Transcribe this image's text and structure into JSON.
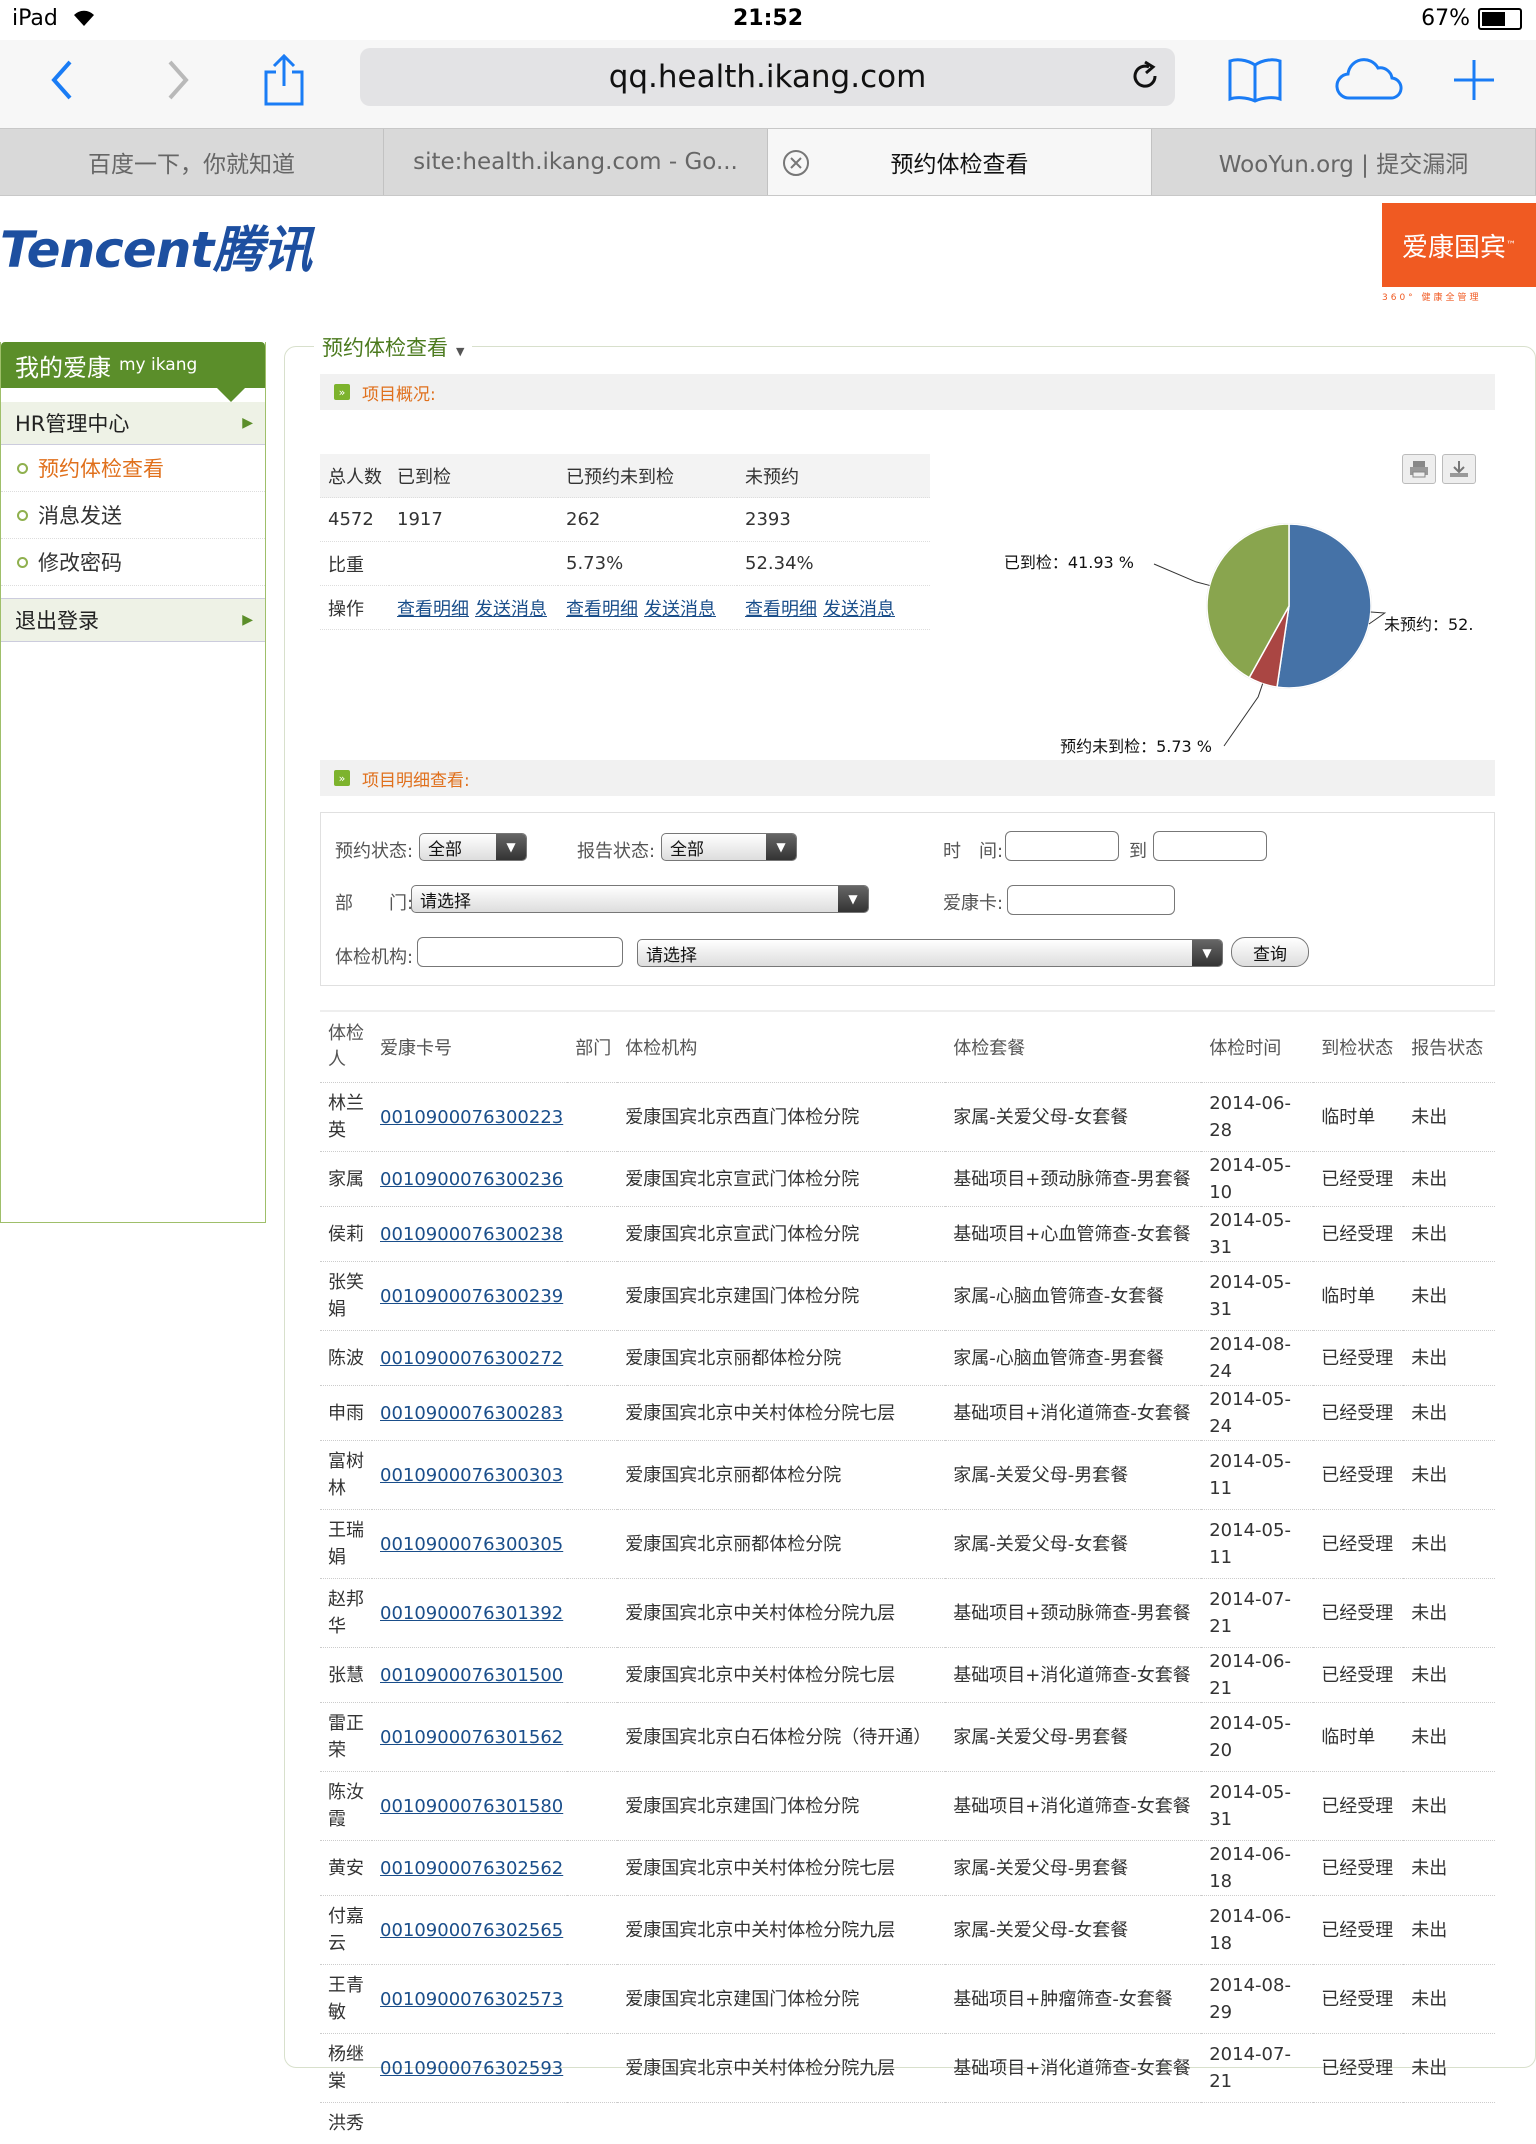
{
  "status_bar": {
    "device": "iPad",
    "time": "21:52",
    "battery": "67%",
    "battery_level": 0.67
  },
  "safari": {
    "url": "qq.health.ikang.com"
  },
  "tabs": [
    {
      "label": "百度一下，你就知道"
    },
    {
      "label": "site:health.ikang.com - Go..."
    },
    {
      "label": "预约体检查看"
    },
    {
      "label": "WooYun.org | 提交漏洞"
    }
  ],
  "header": {
    "logo": "Tencent腾讯",
    "brand": "爱康国宾",
    "brand_tm": "™",
    "brand_sub": "360° 健康全管理"
  },
  "sidebar": {
    "title": "我的爱康",
    "title_en": "my ikang",
    "section": "HR管理中心",
    "items": [
      {
        "label": "预约体检查看"
      },
      {
        "label": "消息发送"
      },
      {
        "label": "修改密码"
      }
    ],
    "logout": "退出登录"
  },
  "main": {
    "title": "预约体检查看",
    "overview_title": "项目概况:",
    "detail_title": "项目明细查看:"
  },
  "summary": {
    "headers": [
      "总人数",
      "已到检",
      "已预约未到检",
      "未预约"
    ],
    "counts": [
      "4572",
      "1917",
      "262",
      "2393"
    ],
    "ratio_label": "比重",
    "ratios": [
      "5.73%",
      "52.34%"
    ],
    "op_label": "操作",
    "view_link": "查看明细",
    "send_link": "发送消息"
  },
  "chart_data": {
    "type": "pie",
    "slices": [
      {
        "label": "未预约",
        "value": 52.34,
        "color": "#4572a7",
        "display": "未预约：52."
      },
      {
        "label": "预约未到检",
        "value": 5.73,
        "color": "#aa4643",
        "display": "预约未到检：5.73 %"
      },
      {
        "label": "已到检",
        "value": 41.93,
        "color": "#89a54e",
        "display": "已到检：41.93 %"
      }
    ]
  },
  "filters": {
    "booking_status_label": "预约状态:",
    "booking_status_value": "全部",
    "report_status_label": "报告状态:",
    "report_status_value": "全部",
    "time_label": "时　间:",
    "to_label": "到",
    "dept_label": "部　　门:",
    "dept_value": "请选择",
    "card_label": "爱康卡:",
    "org_label": "体检机构:",
    "org_value": "请选择",
    "query_button": "查询"
  },
  "detail": {
    "headers": [
      "体检人",
      "爱康卡号",
      "部门",
      "体检机构",
      "体检套餐",
      "体检时间",
      "到检状态",
      "报告状态"
    ],
    "rows": [
      {
        "name": "林兰英",
        "card": "0010900076300223",
        "dept": "",
        "org": "爱康国宾北京西直门体检分院",
        "pkg": "家属-关爱父母-女套餐",
        "date": "2014-06-28",
        "arrival": "临时单",
        "report": "未出"
      },
      {
        "name": "家属",
        "card": "0010900076300236",
        "dept": "",
        "org": "爱康国宾北京宣武门体检分院",
        "pkg": "基础项目+颈动脉筛查-男套餐",
        "date": "2014-05-10",
        "arrival": "已经受理",
        "report": "未出"
      },
      {
        "name": "侯莉",
        "card": "0010900076300238",
        "dept": "",
        "org": "爱康国宾北京宣武门体检分院",
        "pkg": "基础项目+心血管筛查-女套餐",
        "date": "2014-05-31",
        "arrival": "已经受理",
        "report": "未出"
      },
      {
        "name": "张笑娟",
        "card": "0010900076300239",
        "dept": "",
        "org": "爱康国宾北京建国门体检分院",
        "pkg": "家属-心脑血管筛查-女套餐",
        "date": "2014-05-31",
        "arrival": "临时单",
        "report": "未出"
      },
      {
        "name": "陈波",
        "card": "0010900076300272",
        "dept": "",
        "org": "爱康国宾北京丽都体检分院",
        "pkg": "家属-心脑血管筛查-男套餐",
        "date": "2014-08-24",
        "arrival": "已经受理",
        "report": "未出"
      },
      {
        "name": "申雨",
        "card": "0010900076300283",
        "dept": "",
        "org": "爱康国宾北京中关村体检分院七层",
        "pkg": "基础项目+消化道筛查-女套餐",
        "date": "2014-05-24",
        "arrival": "已经受理",
        "report": "未出"
      },
      {
        "name": "富树林",
        "card": "0010900076300303",
        "dept": "",
        "org": "爱康国宾北京丽都体检分院",
        "pkg": "家属-关爱父母-男套餐",
        "date": "2014-05-11",
        "arrival": "已经受理",
        "report": "未出"
      },
      {
        "name": "王瑞娟",
        "card": "0010900076300305",
        "dept": "",
        "org": "爱康国宾北京丽都体检分院",
        "pkg": "家属-关爱父母-女套餐",
        "date": "2014-05-11",
        "arrival": "已经受理",
        "report": "未出"
      },
      {
        "name": "赵邦华",
        "card": "0010900076301392",
        "dept": "",
        "org": "爱康国宾北京中关村体检分院九层",
        "pkg": "基础项目+颈动脉筛查-男套餐",
        "date": "2014-07-21",
        "arrival": "已经受理",
        "report": "未出"
      },
      {
        "name": "张慧",
        "card": "0010900076301500",
        "dept": "",
        "org": "爱康国宾北京中关村体检分院七层",
        "pkg": "基础项目+消化道筛查-女套餐",
        "date": "2014-06-21",
        "arrival": "已经受理",
        "report": "未出"
      },
      {
        "name": "雷正荣",
        "card": "0010900076301562",
        "dept": "",
        "org": "爱康国宾北京白石体检分院（待开通）",
        "pkg": "家属-关爱父母-男套餐",
        "date": "2014-05-20",
        "arrival": "临时单",
        "report": "未出"
      },
      {
        "name": "陈汝霞",
        "card": "0010900076301580",
        "dept": "",
        "org": "爱康国宾北京建国门体检分院",
        "pkg": "基础项目+消化道筛查-女套餐",
        "date": "2014-05-31",
        "arrival": "已经受理",
        "report": "未出"
      },
      {
        "name": "黄安",
        "card": "0010900076302562",
        "dept": "",
        "org": "爱康国宾北京中关村体检分院七层",
        "pkg": "家属-关爱父母-男套餐",
        "date": "2014-06-18",
        "arrival": "已经受理",
        "report": "未出"
      },
      {
        "name": "付嘉云",
        "card": "0010900076302565",
        "dept": "",
        "org": "爱康国宾北京中关村体检分院九层",
        "pkg": "家属-关爱父母-女套餐",
        "date": "2014-06-18",
        "arrival": "已经受理",
        "report": "未出"
      },
      {
        "name": "王青敏",
        "card": "0010900076302573",
        "dept": "",
        "org": "爱康国宾北京建国门体检分院",
        "pkg": "基础项目+肿瘤筛查-女套餐",
        "date": "2014-08-29",
        "arrival": "已经受理",
        "report": "未出"
      },
      {
        "name": "杨继棠",
        "card": "0010900076302593",
        "dept": "",
        "org": "爱康国宾北京中关村体检分院九层",
        "pkg": "基础项目+消化道筛查-女套餐",
        "date": "2014-07-21",
        "arrival": "已经受理",
        "report": "未出"
      }
    ],
    "partial_row_name": "洪秀"
  }
}
